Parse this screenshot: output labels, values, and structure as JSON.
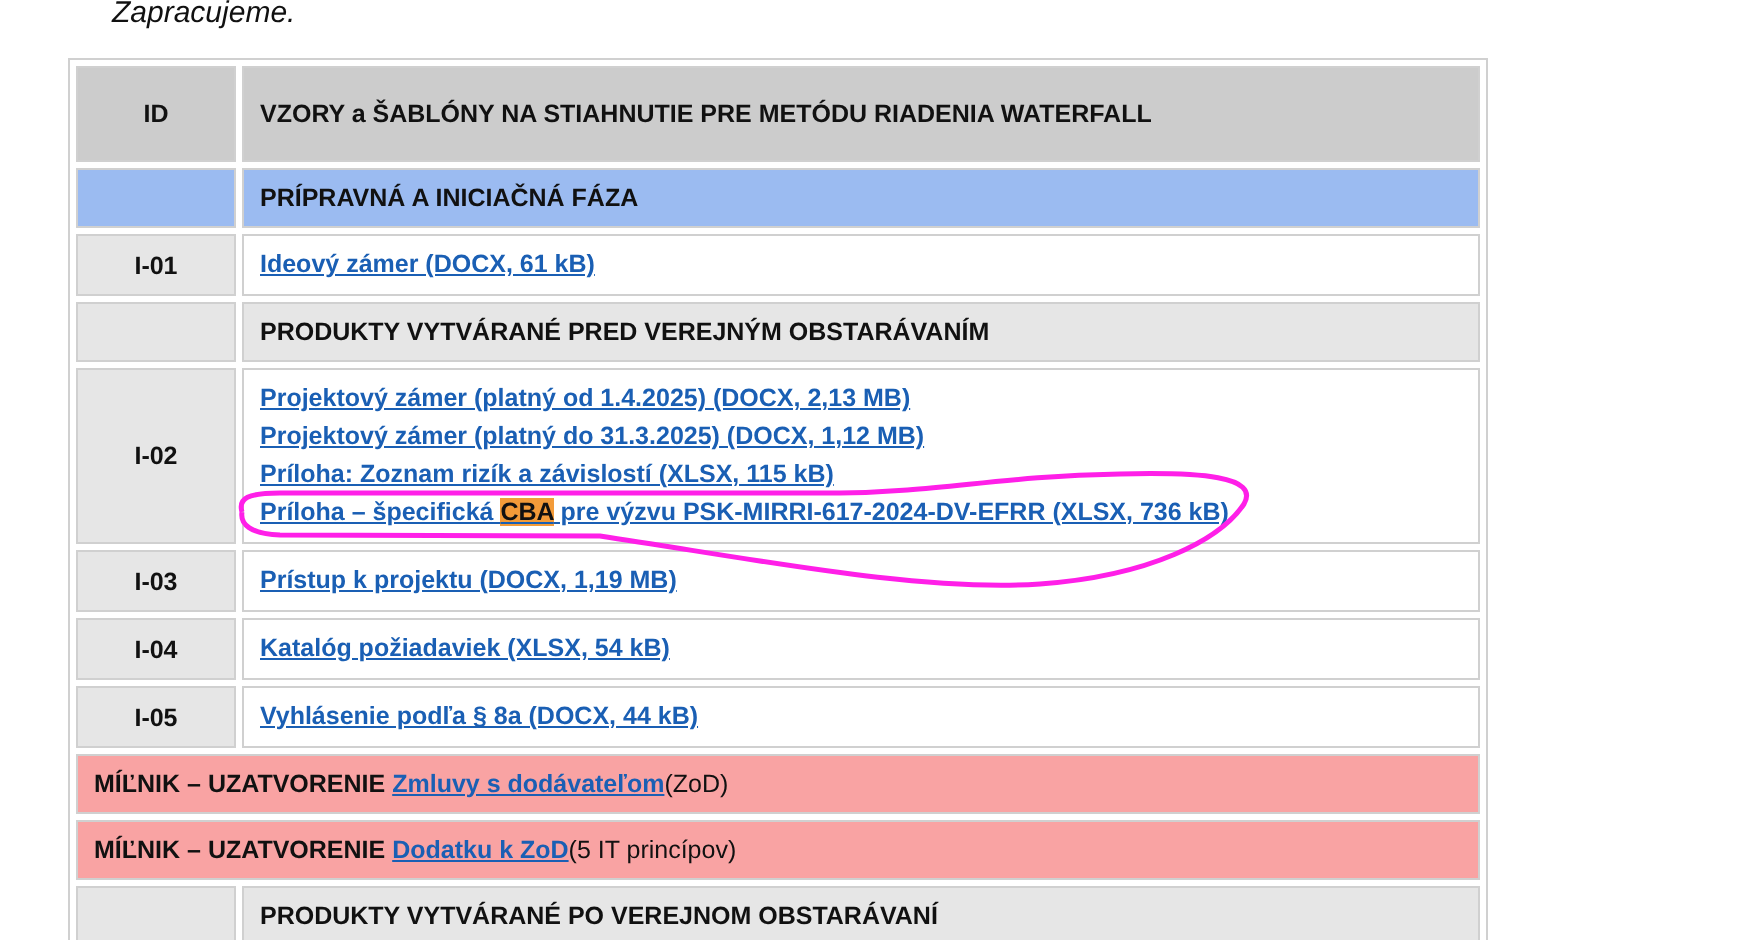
{
  "intro_text": "Zapracujeme.",
  "table": {
    "columns": [
      "ID",
      "VZORY a ŠABLÓNY NA STIAHNUTIE PRE METÓDU RIADENIA WATERFALL"
    ],
    "rows": [
      {
        "kind": "section",
        "title": "PRÍPRAVNÁ A INICIAČNÁ FÁZA",
        "color": "#9bbbf1"
      },
      {
        "kind": "item",
        "id": "I-01",
        "links": [
          {
            "text": "Ideový zámer (DOCX, 61 kB)"
          }
        ]
      },
      {
        "kind": "section",
        "title": "PRODUKTY VYTVÁRANÉ PRED VEREJNÝM OBSTARÁVANÍM",
        "color": "#e6e6e6"
      },
      {
        "kind": "item",
        "id": "I-02",
        "links": [
          {
            "text": "Projektový zámer (platný od 1.4.2025) (DOCX, 2,13 MB)"
          },
          {
            "text": "Projektový zámer (platný do 31.3.2025) (DOCX, 1,12 MB)"
          },
          {
            "text": "Príloha: Zoznam rizík a závislostí (XLSX, 115 kB)"
          },
          {
            "parts": [
              {
                "text": "Príloha – špecifická ",
                "highlighted": false
              },
              {
                "text": "CBA",
                "highlighted": true
              },
              {
                "text": " pre výzvu PSK-MIRRI-617-2024-DV-EFRR (XLSX, 736 kB)",
                "highlighted": false
              }
            ]
          }
        ]
      },
      {
        "kind": "item",
        "id": "I-03",
        "links": [
          {
            "text": "Prístup k projektu (DOCX, 1,19 MB)"
          }
        ]
      },
      {
        "kind": "item",
        "id": "I-04",
        "links": [
          {
            "text": "Katalóg požiadaviek (XLSX, 54 kB)"
          }
        ]
      },
      {
        "kind": "item",
        "id": "I-05",
        "links": [
          {
            "text": "Vyhlásenie podľa § 8a (DOCX, 44 kB)"
          }
        ]
      },
      {
        "kind": "milestone",
        "label": "MÍĽNIK – UZATVORENIE",
        "link": "Zmluvy s dodávateľom",
        "note": "(ZoD)"
      },
      {
        "kind": "milestone",
        "label": "MÍĽNIK – UZATVORENIE",
        "link": "Dodatku k ZoD",
        "note": "(5 IT princípov)"
      },
      {
        "kind": "section",
        "title": "PRODUKTY VYTVÁRANÉ PO VEREJNOM OBSTARÁVANÍ",
        "color": "#e6e6e6"
      }
    ]
  }
}
